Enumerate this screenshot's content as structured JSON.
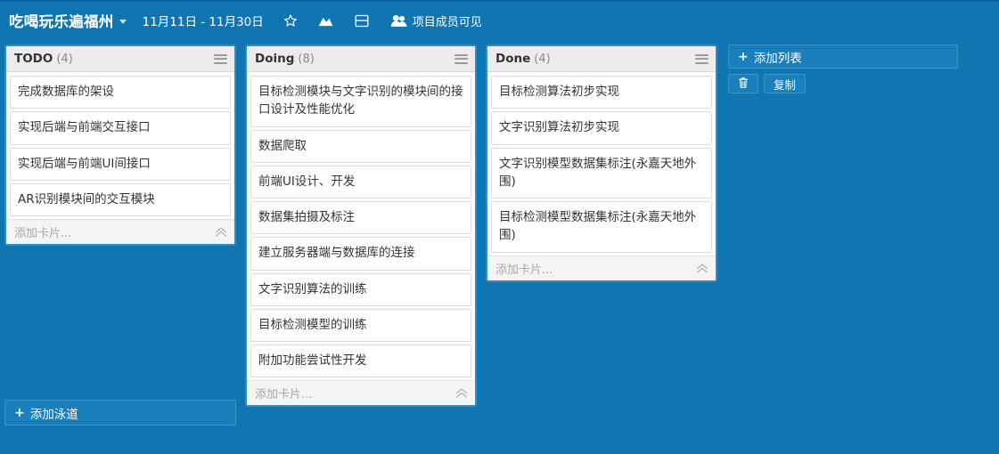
{
  "header": {
    "board_title": "吃喝玩乐遍福州",
    "date_range": "11月11日 - 11月30日",
    "icons": [
      {
        "name": "star-icon",
        "glyph": "☆"
      },
      {
        "name": "chart-icon",
        "glyph": "chart"
      },
      {
        "name": "card-view-icon",
        "glyph": "card"
      },
      {
        "name": "members-icon",
        "glyph": "people"
      }
    ],
    "visibility_label": "项目成员可见"
  },
  "columns": [
    {
      "name": "TODO",
      "count": "(4)",
      "menu_icon": "hamburger-icon",
      "cards": [
        "完成数据库的架设",
        "实现后端与前端交互接口",
        "实现后端与前端UI间接口",
        "AR识别模块间的交互模块"
      ],
      "add_card_placeholder": "添加卡片..."
    },
    {
      "name": "Doing",
      "count": "(8)",
      "menu_icon": "hamburger-icon",
      "cards": [
        "目标检测模块与文字识别的模块间的接口设计及性能优化",
        "数据爬取",
        "前端UI设计、开发",
        "数据集拍摄及标注",
        "建立服务器端与数据库的连接",
        "文字识别算法的训练",
        "目标检测模型的训练",
        "附加功能尝试性开发"
      ],
      "add_card_placeholder": "添加卡片..."
    },
    {
      "name": "Done",
      "count": "(4)",
      "menu_icon": "hamburger-icon",
      "cards": [
        "目标检测算法初步实现",
        "文字识别算法初步实现",
        "文字识别模型数据集标注(永嘉天地外围)",
        "目标检测模型数据集标注(永嘉天地外围)"
      ],
      "add_card_placeholder": "添加卡片..."
    }
  ],
  "side_panel": {
    "add_list_label": "添加列表",
    "delete_icon": "trash-icon",
    "copy_label": "复制"
  },
  "footer": {
    "add_swimlane_label": "添加泳道"
  },
  "colors": {
    "board_background": "#1175b1",
    "column_border": "#2d8fc8",
    "column_header_bg": "#ececec",
    "card_bg": "#ffffff",
    "button_bg": "#1a7fbb",
    "text_primary": "#333333",
    "text_muted": "#8a8a8a"
  }
}
